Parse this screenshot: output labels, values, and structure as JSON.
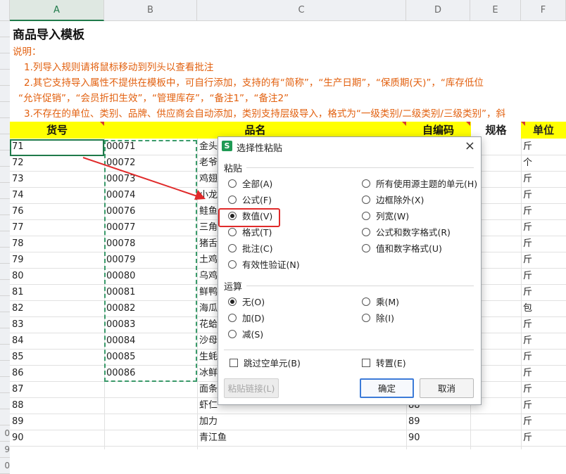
{
  "columns": [
    "A",
    "B",
    "C",
    "D",
    "E",
    "F"
  ],
  "row_numbers": [
    "",
    "",
    "",
    "",
    "",
    "",
    "",
    "",
    "",
    "",
    "",
    "",
    "",
    "",
    "",
    "",
    "",
    "",
    "",
    "",
    "",
    "",
    "",
    "",
    "",
    "0",
    "9",
    "0"
  ],
  "sheet": {
    "title": "商品导入模板",
    "notes": [
      "说明：",
      "1.列导入规则请将鼠标移动到列头以查看批注",
      "2.其它支持导入属性不提供在模板中，可自行添加，支持的有“简称”，“生产日期”，“保质期(天)”，“库存低位",
      "“允许促销”，“会员折扣生效”，“管理库存”，“备注1”，“备注2”",
      "3.不存在的单位、类别、品牌、供应商会自动添加，类别支持层级导入，格式为“一级类别/二级类别/三级类别”，斜"
    ],
    "headers": [
      "货号",
      "品名",
      "自编码",
      "规格",
      "单位"
    ],
    "rows": [
      {
        "a": "71",
        "b": "00071",
        "c": "金头",
        "d": "",
        "f": "斤"
      },
      {
        "a": "72",
        "b": "00072",
        "c": "老爷",
        "d": "",
        "f": "个"
      },
      {
        "a": "73",
        "b": "00073",
        "c": "鸡翅",
        "d": "",
        "f": "斤"
      },
      {
        "a": "74",
        "b": "00074",
        "c": "小龙",
        "d": "",
        "f": "斤"
      },
      {
        "a": "76",
        "b": "00076",
        "c": "鲑鱼",
        "d": "",
        "f": "斤"
      },
      {
        "a": "77",
        "b": "00077",
        "c": "三角",
        "d": "",
        "f": "斤"
      },
      {
        "a": "78",
        "b": "00078",
        "c": "猪舌",
        "d": "",
        "f": "斤"
      },
      {
        "a": "79",
        "b": "00079",
        "c": "土鸡",
        "d": "",
        "f": "斤"
      },
      {
        "a": "80",
        "b": "00080",
        "c": "乌鸡",
        "d": "",
        "f": "斤"
      },
      {
        "a": "81",
        "b": "00081",
        "c": "鲜鸭",
        "d": "",
        "f": "斤"
      },
      {
        "a": "82",
        "b": "00082",
        "c": "海瓜",
        "d": "",
        "f": "包"
      },
      {
        "a": "83",
        "b": "00083",
        "c": "花蛤",
        "d": "",
        "f": "斤"
      },
      {
        "a": "84",
        "b": "00084",
        "c": "沙母",
        "d": "",
        "f": "斤"
      },
      {
        "a": "85",
        "b": "00085",
        "c": "生蚝",
        "d": "",
        "f": "斤"
      },
      {
        "a": "86",
        "b": "00086",
        "c": "冰鲜",
        "d": "",
        "f": "斤"
      },
      {
        "a": "87",
        "b": "",
        "c": "面条",
        "d": "",
        "f": "斤"
      },
      {
        "a": "88",
        "b": "",
        "c": "虾仁",
        "d": "88",
        "f": "斤"
      },
      {
        "a": "89",
        "b": "",
        "c": "加力",
        "d": "89",
        "f": "斤"
      },
      {
        "a": "90",
        "b": "",
        "c": "青江鱼",
        "d": "90",
        "f": "斤"
      }
    ]
  },
  "dialog": {
    "logo": "S",
    "title": "选择性粘贴",
    "close": "×",
    "paste_section": "粘贴",
    "paste_left": [
      "全部(A)",
      "公式(F)",
      "数值(V)",
      "格式(T)",
      "批注(C)",
      "有效性验证(N)"
    ],
    "paste_right": [
      "所有使用源主题的单元(H)",
      "边框除外(X)",
      "列宽(W)",
      "公式和数字格式(R)",
      "值和数字格式(U)"
    ],
    "paste_selected": "数值(V)",
    "operation_section": "运算",
    "op_left": [
      "无(O)",
      "加(D)",
      "减(S)"
    ],
    "op_right": [
      "乘(M)",
      "除(I)"
    ],
    "op_selected": "无(O)",
    "skip_blanks": "跳过空单元(B)",
    "transpose": "转置(E)",
    "paste_link": "粘贴链接(L)",
    "ok": "确定",
    "cancel": "取消"
  },
  "colors": {
    "accent": "#1f7a4a",
    "header_fill": "#ffff00",
    "note_text": "#e2600f",
    "highlight": "#e02a2a"
  }
}
